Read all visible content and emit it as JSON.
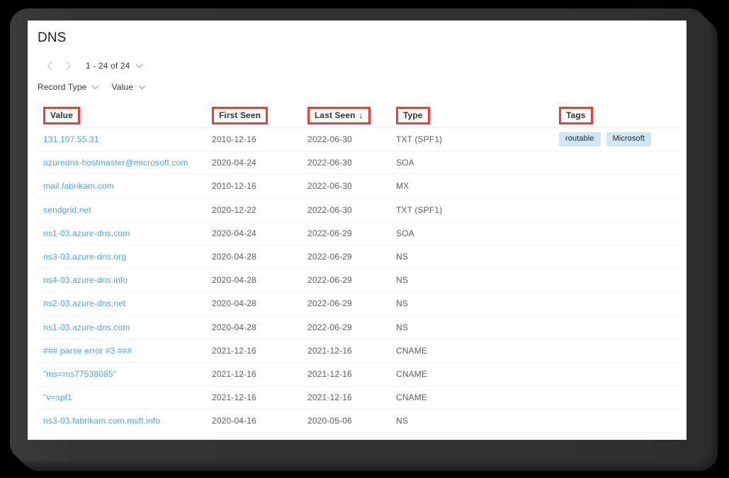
{
  "page": {
    "title": "DNS"
  },
  "pager": {
    "prev_icon": "chevron-left-icon",
    "next_icon": "chevron-right-icon",
    "range_label": "1 - 24 of 24",
    "dropdown_icon": "chevron-down-icon"
  },
  "filters": [
    {
      "label": "Record Type",
      "icon": "chevron-down-icon"
    },
    {
      "label": "Value",
      "icon": "chevron-down-icon"
    }
  ],
  "table": {
    "columns": [
      {
        "key": "value",
        "label": "Value",
        "highlighted": true
      },
      {
        "key": "first_seen",
        "label": "First Seen",
        "highlighted": true
      },
      {
        "key": "last_seen",
        "label": "Last Seen",
        "highlighted": true,
        "sort": "↓"
      },
      {
        "key": "type",
        "label": "Type",
        "highlighted": true
      },
      {
        "key": "tags",
        "label": "Tags",
        "highlighted": true
      }
    ],
    "rows": [
      {
        "value": "131.107.55.31",
        "first_seen": "2010-12-16",
        "last_seen": "2022-06-30",
        "type": "TXT (SPF1)",
        "tags": [
          "routable",
          "Microsoft"
        ]
      },
      {
        "value": "azuredns-hostmaster@microsoft.com",
        "first_seen": "2020-04-24",
        "last_seen": "2022-06-30",
        "type": "SOA",
        "tags": []
      },
      {
        "value": "mail.fabrikam.com",
        "first_seen": "2010-12-16",
        "last_seen": "2022-06-30",
        "type": "MX",
        "tags": []
      },
      {
        "value": "sendgrid.net",
        "first_seen": "2020-12-22",
        "last_seen": "2022-06-30",
        "type": "TXT (SPF1)",
        "tags": []
      },
      {
        "value": "ns1-03.azure-dns.com",
        "first_seen": "2020-04-24",
        "last_seen": "2022-06-29",
        "type": "SOA",
        "tags": []
      },
      {
        "value": "ns3-03.azure-dns.org",
        "first_seen": "2020-04-28",
        "last_seen": "2022-06-29",
        "type": "NS",
        "tags": []
      },
      {
        "value": "ns4-03.azure-dns.info",
        "first_seen": "2020-04-28",
        "last_seen": "2022-06-29",
        "type": "NS",
        "tags": []
      },
      {
        "value": "ns2-03.azure-dns.net",
        "first_seen": "2020-04-28",
        "last_seen": "2022-06-29",
        "type": "NS",
        "tags": []
      },
      {
        "value": "ns1-03.azure-dns.com",
        "first_seen": "2020-04-28",
        "last_seen": "2022-06-29",
        "type": "NS",
        "tags": []
      },
      {
        "value": "### parse error #3 ###",
        "first_seen": "2021-12-16",
        "last_seen": "2021-12-16",
        "type": "CNAME",
        "tags": []
      },
      {
        "value": "\"ms=ms77538085\"",
        "first_seen": "2021-12-16",
        "last_seen": "2021-12-16",
        "type": "CNAME",
        "tags": []
      },
      {
        "value": "\"v=spf1",
        "first_seen": "2021-12-16",
        "last_seen": "2021-12-16",
        "type": "CNAME",
        "tags": []
      },
      {
        "value": "ns3-03.fabrikam.com.msft.info",
        "first_seen": "2020-04-16",
        "last_seen": "2020-05-06",
        "type": "NS",
        "tags": []
      }
    ]
  },
  "colors": {
    "annotation_red": "#ef3b3b",
    "link_blue": "#4ca3e8",
    "tag_background": "#cfe6f7",
    "frame_dark": "#323232"
  }
}
